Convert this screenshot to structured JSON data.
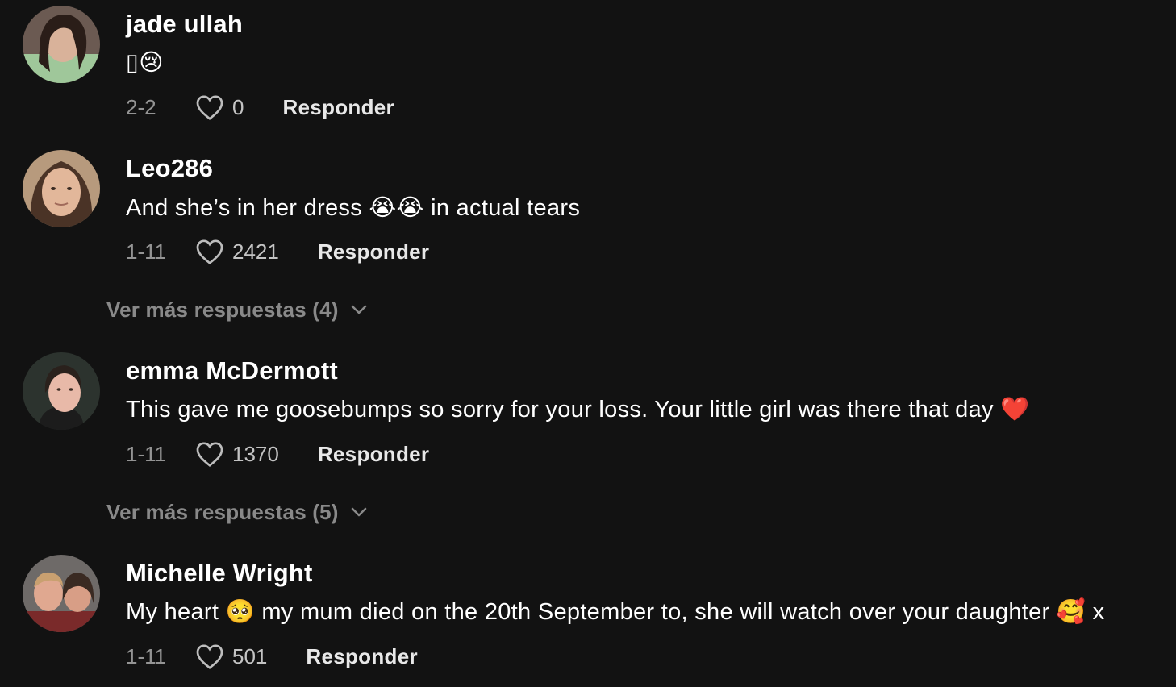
{
  "comments": [
    {
      "username": "jade ullah",
      "text": "▯😢",
      "date": "2-2",
      "likes": "0",
      "reply_label": "Responder"
    },
    {
      "username": "Leo286",
      "text": "And she’s in her dress 😭😭 in actual tears",
      "date": "1-11",
      "likes": "2421",
      "reply_label": "Responder",
      "more_replies": "Ver más respuestas (4)"
    },
    {
      "username": "emma McDermott",
      "text": "This gave me goosebumps so sorry for your loss. Your little girl was there that day ❤️",
      "date": "1-11",
      "likes": "1370",
      "reply_label": "Responder",
      "more_replies": "Ver más respuestas (5)"
    },
    {
      "username": "Michelle Wright",
      "text": "My heart 🥺 my mum died on the 20th September to, she will watch over your daughter 🥰 x",
      "date": "1-11",
      "likes": "501",
      "reply_label": "Responder"
    }
  ],
  "icons": {
    "like": "heart-outline-icon",
    "expand": "chevron-down-icon"
  },
  "colors": {
    "background": "#121212",
    "text": "#ffffff",
    "muted": "#8a8a8a"
  }
}
